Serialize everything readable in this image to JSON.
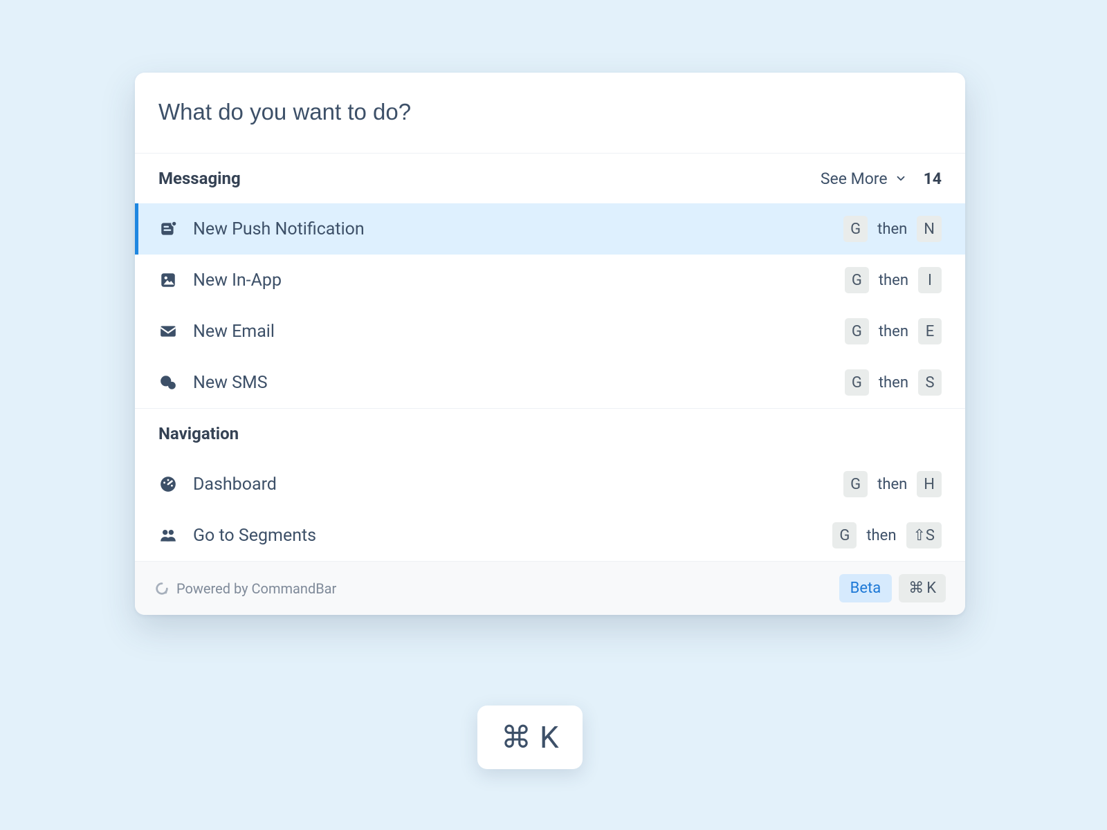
{
  "search": {
    "placeholder": "What do you want to do?",
    "value": ""
  },
  "sections": [
    {
      "title": "Messaging",
      "see_more": "See More",
      "count": "14",
      "items": [
        {
          "label": "New Push Notification",
          "icon": "push-icon",
          "keys": [
            "G",
            "N"
          ],
          "selected": true
        },
        {
          "label": "New In-App",
          "icon": "inapp-icon",
          "keys": [
            "G",
            "I"
          ],
          "selected": false
        },
        {
          "label": "New Email",
          "icon": "email-icon",
          "keys": [
            "G",
            "E"
          ],
          "selected": false
        },
        {
          "label": "New SMS",
          "icon": "sms-icon",
          "keys": [
            "G",
            "S"
          ],
          "selected": false
        }
      ]
    },
    {
      "title": "Navigation",
      "items": [
        {
          "label": "Dashboard",
          "icon": "dashboard-icon",
          "keys": [
            "G",
            "H"
          ],
          "selected": false
        },
        {
          "label": "Go to Segments",
          "icon": "segments-icon",
          "keys": [
            "G",
            "⇧S"
          ],
          "selected": false
        }
      ]
    }
  ],
  "footer": {
    "powered": "Powered by CommandBar",
    "beta": "Beta",
    "hotkey_cmd": "⌘",
    "hotkey_key": "K"
  },
  "launcher": {
    "cmd": "⌘",
    "key": "K"
  },
  "shortcut_separator": "then"
}
